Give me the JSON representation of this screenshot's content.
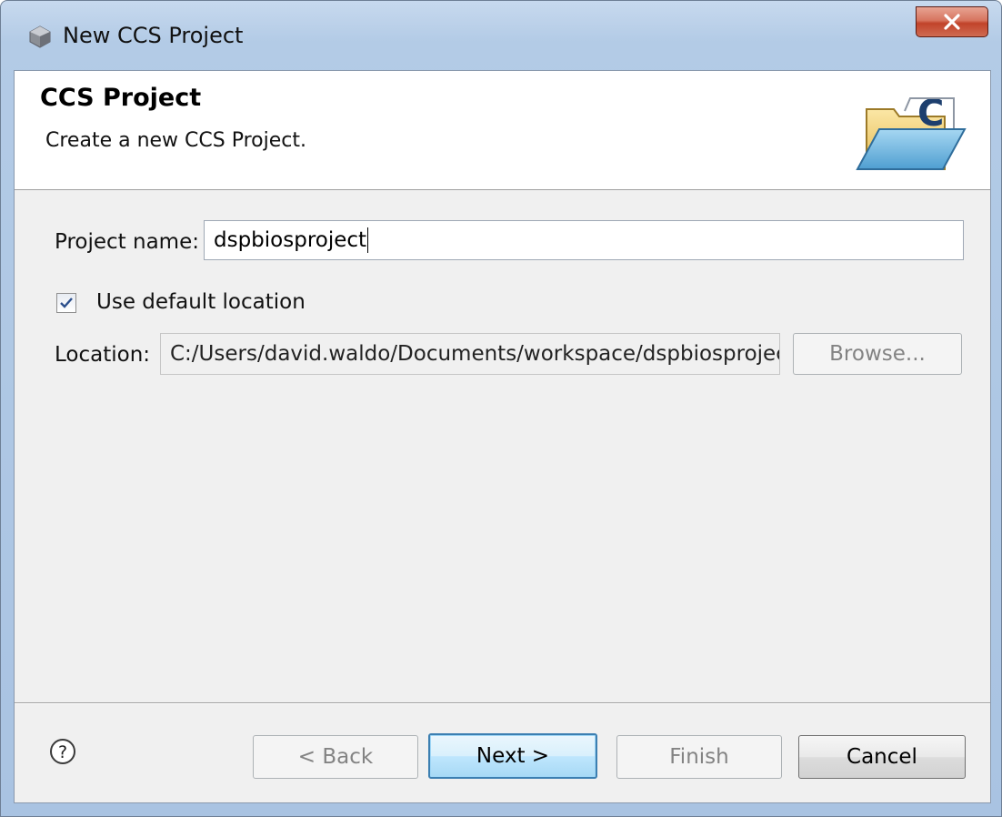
{
  "window": {
    "title": "New CCS Project",
    "close_glyph": "x"
  },
  "banner": {
    "title": "CCS Project",
    "description": "Create a new CCS Project.",
    "icon": "ccs-folder-icon"
  },
  "form": {
    "project_name_label": "Project name:",
    "project_name_value": "dspbiosproject",
    "use_default_location_label": "Use default location",
    "use_default_location_checked": true,
    "location_label": "Location:",
    "location_value": "C:/Users/david.waldo/Documents/workspace/dspbiosprojec",
    "browse_label": "Browse..."
  },
  "footer": {
    "help_icon": "help-icon",
    "back_label": "< Back",
    "next_label": "Next >",
    "finish_label": "Finish",
    "cancel_label": "Cancel"
  },
  "colors": {
    "accent": "#3c7fb1",
    "close": "#c1432a"
  }
}
